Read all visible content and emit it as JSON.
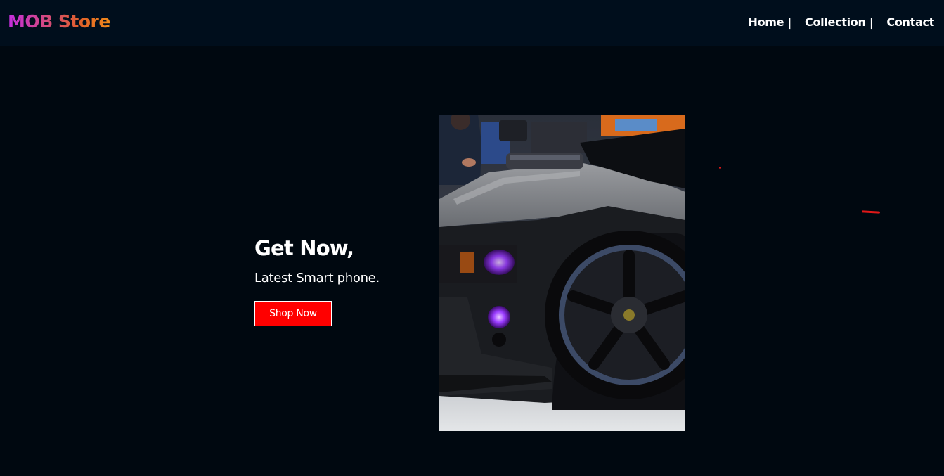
{
  "brand": {
    "logo_text": "MOB Store"
  },
  "nav": {
    "items": [
      {
        "label": "Home |"
      },
      {
        "label": "Collection |"
      },
      {
        "label": "Contact"
      }
    ]
  },
  "hero": {
    "heading": "Get Now,",
    "subheading": "Latest Smart phone.",
    "cta_label": "Shop Now",
    "image_icon": "car-photo"
  },
  "colors": {
    "background": "#000810",
    "navbar": "#000e1c",
    "cta": "#ff0000",
    "accent": "#e01818",
    "logo_gradient_start": "#c42ee0",
    "logo_gradient_end": "#f08a1a"
  }
}
